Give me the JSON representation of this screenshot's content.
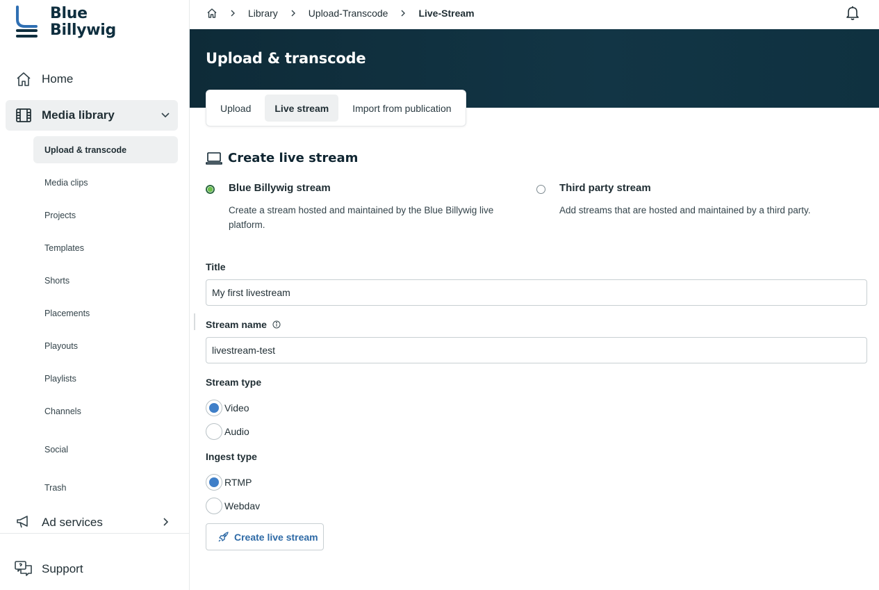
{
  "brand": {
    "line1": "Blue",
    "line2": "Billywig"
  },
  "sidebar": {
    "home": "Home",
    "media_library": "Media library",
    "sub_items": [
      "Upload & transcode",
      "Media clips",
      "Projects",
      "Templates",
      "Shorts",
      "Placements",
      "Playouts",
      "Playlists",
      "Channels",
      "Social",
      "Trash"
    ],
    "ad_services": "Ad services",
    "support": "Support"
  },
  "breadcrumb": {
    "items": [
      "Library",
      "Upload-Transcode"
    ],
    "current": "Live-Stream"
  },
  "header": {
    "title": "Upload & transcode"
  },
  "tabs": [
    "Upload",
    "Live stream",
    "Import from publication"
  ],
  "section": {
    "title": "Create live stream"
  },
  "stream_choice": {
    "option1": {
      "title": "Blue Billywig stream",
      "description": "Create a stream hosted and maintained by the Blue Billywig live platform.",
      "selected": true
    },
    "option2": {
      "title": "Third party stream",
      "description": "Add streams that are hosted and maintained by a third party.",
      "selected": false
    }
  },
  "form": {
    "title_label": "Title",
    "title_value": "My first livestream",
    "stream_name_label": "Stream name",
    "stream_name_value": "livestream-test",
    "stream_type_label": "Stream type",
    "stream_type_options": [
      "Video",
      "Audio"
    ],
    "stream_type_selected": "Video",
    "ingest_type_label": "Ingest type",
    "ingest_type_options": [
      "RTMP",
      "Webdav"
    ],
    "ingest_type_selected": "RTMP",
    "submit_label": "Create live stream"
  },
  "icons": [
    "home-icon",
    "film-icon",
    "chevron-down-icon",
    "megaphone-icon",
    "chevron-right-icon",
    "support-icon",
    "bell-icon",
    "laptop-icon",
    "info-icon",
    "rocket-icon"
  ],
  "colors": {
    "banner": "#0e2b38",
    "accent_blue": "#3f7fc8",
    "link_blue": "#2e6aa6",
    "radio_green": "#6bbf4a"
  }
}
